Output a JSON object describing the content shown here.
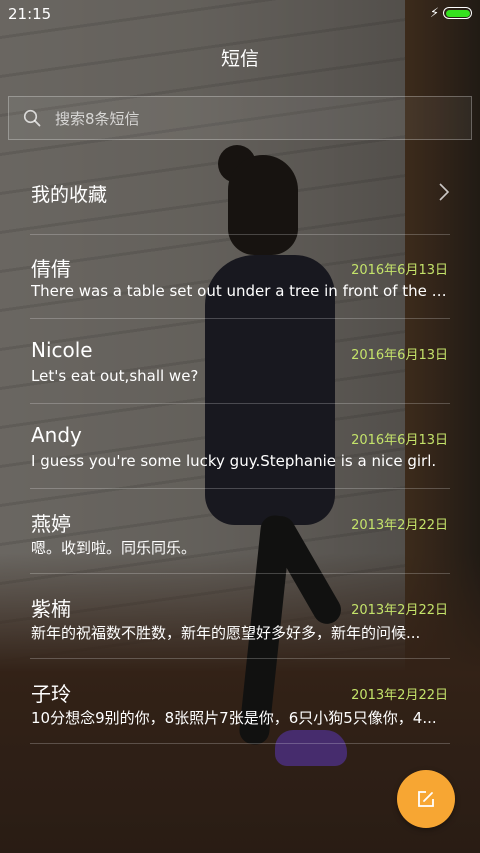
{
  "status_bar": {
    "time": "21:15",
    "battery_color": "#35e11e",
    "icons": [
      "flash-icon",
      "battery-icon"
    ]
  },
  "header": {
    "title": "短信"
  },
  "search": {
    "placeholder": "搜索8条短信",
    "icon": "search-icon"
  },
  "favorites": {
    "label": "我的收藏",
    "icon": "chevron-right-icon"
  },
  "conversations": [
    {
      "name": "倩倩",
      "date": "2016年6月13日",
      "preview": "There was a table set out under a tree in front of the ho..."
    },
    {
      "name": "Nicole",
      "date": "2016年6月13日",
      "preview": "Let's eat out,shall we?"
    },
    {
      "name": "Andy",
      "date": "2016年6月13日",
      "preview": "I guess you're some lucky guy.Stephanie is a nice girl."
    },
    {
      "name": "燕婷",
      "date": "2013年2月22日",
      "preview": "嗯。收到啦。同乐同乐。"
    },
    {
      "name": "紫楠",
      "date": "2013年2月22日",
      "preview": "新年的祝福数不胜数，新年的愿望好多好多，新年的问候..."
    },
    {
      "name": "子玲",
      "date": "2013年2月22日",
      "preview": "10分想念9别的你，8张照片7张是你，6只小狗5只像你，4..."
    }
  ],
  "colors": {
    "date_accent": "#c4e36a",
    "fab": "#f7a633"
  },
  "fab": {
    "icon": "compose-icon"
  }
}
